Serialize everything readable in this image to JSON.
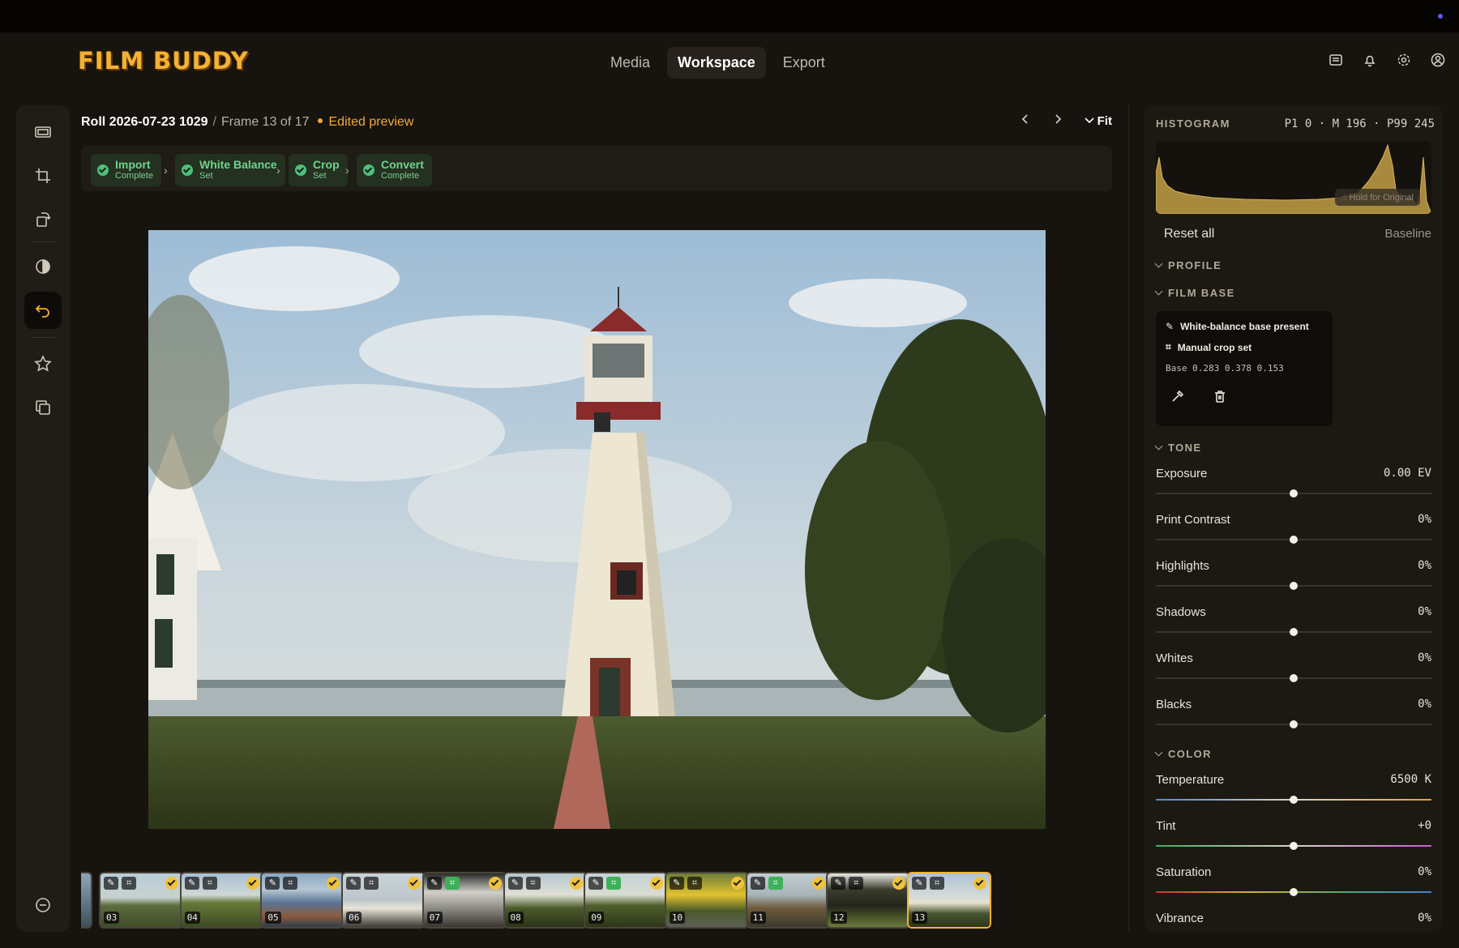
{
  "app": {
    "logo": "FILM BUDDY"
  },
  "nav": {
    "tabs": [
      "Media",
      "Workspace",
      "Export"
    ],
    "active": "Workspace"
  },
  "header_icons": [
    "notes-icon",
    "bell-icon",
    "gear-icon",
    "user-icon"
  ],
  "left_tools": [
    "frames-icon",
    "crop-icon",
    "rotate-icon",
    "contrast-icon",
    "undo-icon",
    "star-icon",
    "copy-icon",
    "minus-circle-icon"
  ],
  "breadcrumb": {
    "roll": "Roll 2026-07-23 1029",
    "separator": "/",
    "frame": "Frame 13 of 17",
    "status": "Edited preview"
  },
  "view": {
    "zoom": "Fit"
  },
  "pipeline": [
    {
      "title": "Import",
      "status": "Complete"
    },
    {
      "title": "White Balance",
      "status": "Set"
    },
    {
      "title": "Crop",
      "status": "Set"
    },
    {
      "title": "Convert",
      "status": "Complete"
    }
  ],
  "filmstrip": [
    {
      "num": "03",
      "edits": [
        "✎",
        "⌗"
      ],
      "crop_green": false
    },
    {
      "num": "04",
      "edits": [
        "✎",
        "⌗"
      ],
      "crop_green": false
    },
    {
      "num": "05",
      "edits": [
        "✎",
        "⌗"
      ],
      "crop_green": false
    },
    {
      "num": "06",
      "edits": [
        "✎",
        "⌗"
      ],
      "crop_green": false
    },
    {
      "num": "07",
      "edits": [
        "✎",
        "⌗"
      ],
      "crop_green": true
    },
    {
      "num": "08",
      "edits": [
        "✎",
        "⌗"
      ],
      "crop_green": false
    },
    {
      "num": "09",
      "edits": [
        "✎",
        "⌗"
      ],
      "crop_green": true
    },
    {
      "num": "10",
      "edits": [
        "✎",
        "⌗"
      ],
      "crop_green": false
    },
    {
      "num": "11",
      "edits": [
        "✎",
        "⌗"
      ],
      "crop_green": true
    },
    {
      "num": "12",
      "edits": [
        "✎",
        "⌗"
      ],
      "crop_green": false
    },
    {
      "num": "13",
      "edits": [
        "✎",
        "⌗"
      ],
      "crop_green": false
    }
  ],
  "selected_frame": "13",
  "histogram": {
    "label": "HISTOGRAM",
    "stats": "P1 0 · M 196 · P99 245",
    "hold_label": "Hold for Original"
  },
  "panel": {
    "reset_label": "Reset all",
    "baseline_label": "Baseline"
  },
  "sections": {
    "profile": "PROFILE",
    "film_base": "FILM BASE",
    "tone": "TONE",
    "color": "COLOR"
  },
  "film_base": {
    "line1": "White-balance base present",
    "line2": "Manual crop set",
    "base_values": "Base 0.283 0.378 0.153"
  },
  "tone": [
    {
      "name": "Exposure",
      "value": "0.00 EV",
      "level": 0.5
    },
    {
      "name": "Print Contrast",
      "value": "0%",
      "level": 0.5
    },
    {
      "name": "Highlights",
      "value": "0%",
      "level": 0.5
    },
    {
      "name": "Shadows",
      "value": "0%",
      "level": 0.5
    },
    {
      "name": "Whites",
      "value": "0%",
      "level": 0.5
    },
    {
      "name": "Blacks",
      "value": "0%",
      "level": 0.5
    }
  ],
  "color": [
    {
      "name": "Temperature",
      "value": "6500 K",
      "level": 0.5
    },
    {
      "name": "Tint",
      "value": "+0",
      "level": 0.5
    },
    {
      "name": "Saturation",
      "value": "0%",
      "level": 0.5
    },
    {
      "name": "Vibrance",
      "value": "0%",
      "level": 0.5
    }
  ],
  "colors": {
    "accent": "#f2b233",
    "edited": "#f2a83a",
    "success": "#4cc07a"
  }
}
